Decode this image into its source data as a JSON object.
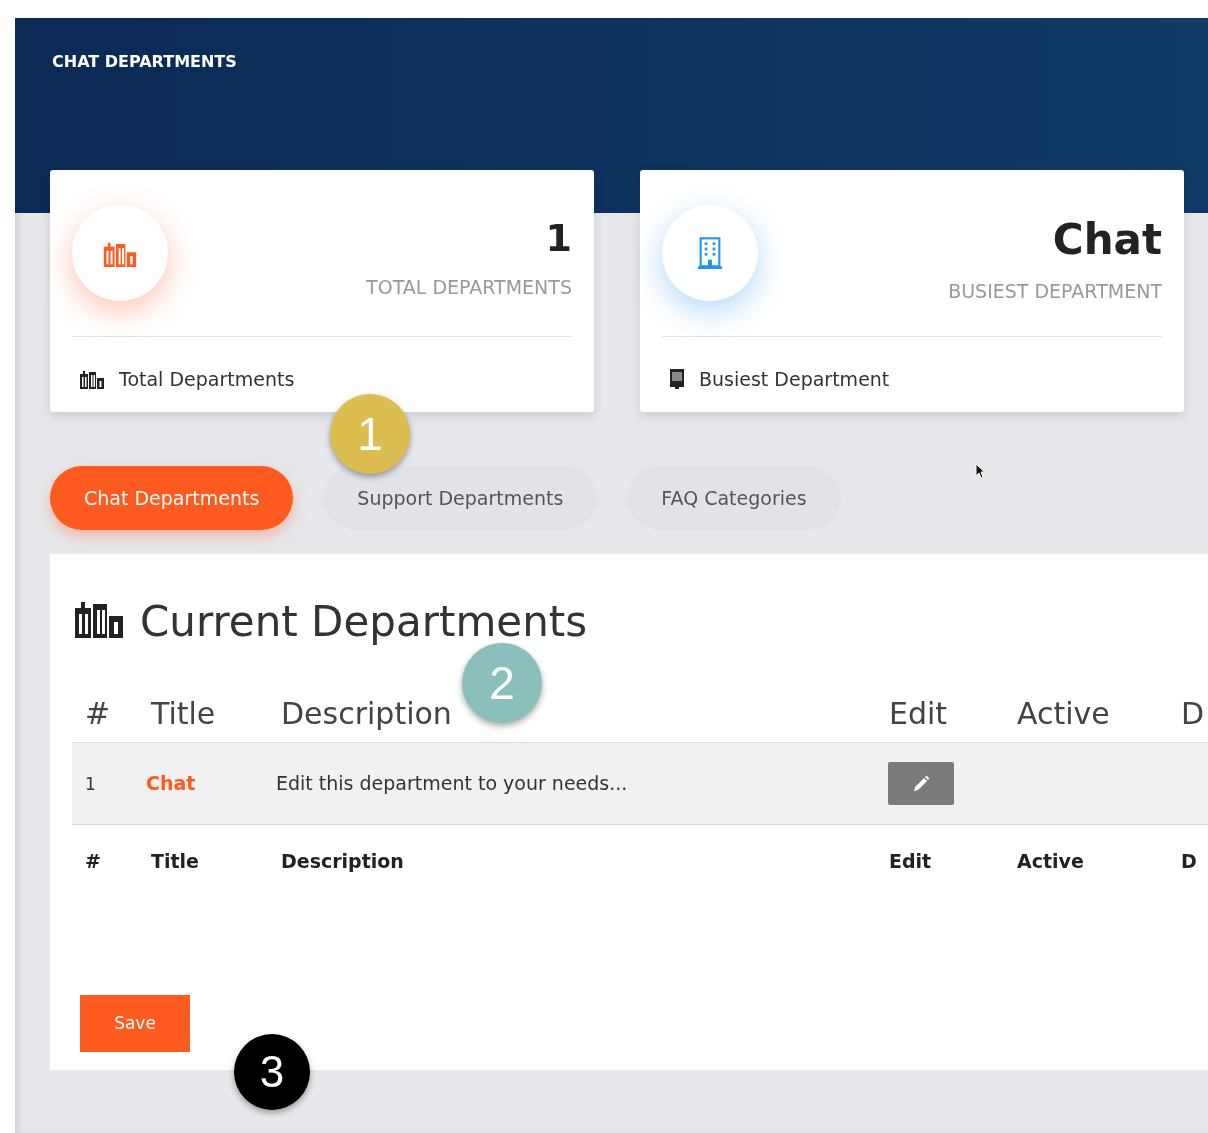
{
  "header": {
    "title": "CHAT DEPARTMENTS"
  },
  "stats": [
    {
      "kind": "count",
      "value": "1",
      "label": "TOTAL DEPARTMENTS",
      "footer": "Total Departments"
    },
    {
      "kind": "busiest",
      "value": "Chat",
      "label": "BUSIEST DEPARTMENT",
      "footer": "Busiest Department"
    }
  ],
  "tabs": [
    {
      "label": "Chat Departments",
      "selected": true
    },
    {
      "label": "Support Departments",
      "selected": false
    },
    {
      "label": "FAQ Categories",
      "selected": false
    }
  ],
  "panel": {
    "title": "Current Departments",
    "columns": [
      "#",
      "Title",
      "Description",
      "Edit",
      "Active",
      "D"
    ],
    "rows": [
      {
        "number": "1",
        "title": "Chat",
        "description": "Edit this department to your needs..."
      }
    ],
    "footer_columns": [
      "#",
      "Title",
      "Description",
      "Edit",
      "Active",
      "D"
    ],
    "save_button": "Save"
  },
  "callouts": [
    {
      "label": "1",
      "color": "#dcbd4f"
    },
    {
      "label": "2",
      "color": "#8bbfbc"
    },
    {
      "label": "3",
      "color": "#000000"
    }
  ]
}
